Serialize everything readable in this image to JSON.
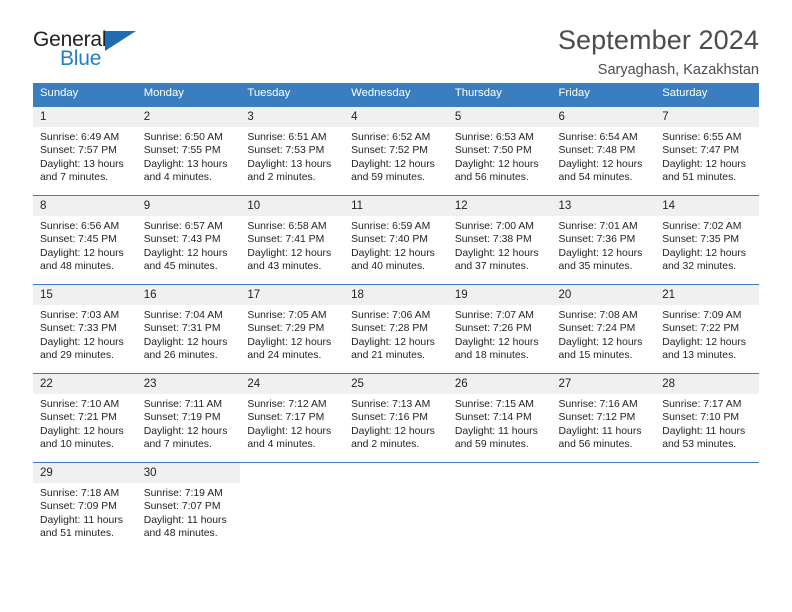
{
  "brand": {
    "name_dark": "General",
    "name_blue": "Blue",
    "triangle_color": "#1f6cb0"
  },
  "header": {
    "title": "September 2024",
    "location": "Saryaghash, Kazakhstan"
  },
  "theme": {
    "header_blue": "#3a7ebf",
    "daynum_background": "#f0f0f0",
    "text": "#231f20",
    "title_gray": "#4c4c4e"
  },
  "labels": {
    "sunrise_prefix": "Sunrise:",
    "sunset_prefix": "Sunset:",
    "daylight_prefix": "Daylight:"
  },
  "weekdays": [
    "Sunday",
    "Monday",
    "Tuesday",
    "Wednesday",
    "Thursday",
    "Friday",
    "Saturday"
  ],
  "weeks": [
    [
      {
        "day": "1",
        "sunrise": "Sunrise: 6:49 AM",
        "sunset": "Sunset: 7:57 PM",
        "daylight_line1": "Daylight: 13 hours",
        "daylight_line2": "and 7 minutes."
      },
      {
        "day": "2",
        "sunrise": "Sunrise: 6:50 AM",
        "sunset": "Sunset: 7:55 PM",
        "daylight_line1": "Daylight: 13 hours",
        "daylight_line2": "and 4 minutes."
      },
      {
        "day": "3",
        "sunrise": "Sunrise: 6:51 AM",
        "sunset": "Sunset: 7:53 PM",
        "daylight_line1": "Daylight: 13 hours",
        "daylight_line2": "and 2 minutes."
      },
      {
        "day": "4",
        "sunrise": "Sunrise: 6:52 AM",
        "sunset": "Sunset: 7:52 PM",
        "daylight_line1": "Daylight: 12 hours",
        "daylight_line2": "and 59 minutes."
      },
      {
        "day": "5",
        "sunrise": "Sunrise: 6:53 AM",
        "sunset": "Sunset: 7:50 PM",
        "daylight_line1": "Daylight: 12 hours",
        "daylight_line2": "and 56 minutes."
      },
      {
        "day": "6",
        "sunrise": "Sunrise: 6:54 AM",
        "sunset": "Sunset: 7:48 PM",
        "daylight_line1": "Daylight: 12 hours",
        "daylight_line2": "and 54 minutes."
      },
      {
        "day": "7",
        "sunrise": "Sunrise: 6:55 AM",
        "sunset": "Sunset: 7:47 PM",
        "daylight_line1": "Daylight: 12 hours",
        "daylight_line2": "and 51 minutes."
      }
    ],
    [
      {
        "day": "8",
        "sunrise": "Sunrise: 6:56 AM",
        "sunset": "Sunset: 7:45 PM",
        "daylight_line1": "Daylight: 12 hours",
        "daylight_line2": "and 48 minutes."
      },
      {
        "day": "9",
        "sunrise": "Sunrise: 6:57 AM",
        "sunset": "Sunset: 7:43 PM",
        "daylight_line1": "Daylight: 12 hours",
        "daylight_line2": "and 45 minutes."
      },
      {
        "day": "10",
        "sunrise": "Sunrise: 6:58 AM",
        "sunset": "Sunset: 7:41 PM",
        "daylight_line1": "Daylight: 12 hours",
        "daylight_line2": "and 43 minutes."
      },
      {
        "day": "11",
        "sunrise": "Sunrise: 6:59 AM",
        "sunset": "Sunset: 7:40 PM",
        "daylight_line1": "Daylight: 12 hours",
        "daylight_line2": "and 40 minutes."
      },
      {
        "day": "12",
        "sunrise": "Sunrise: 7:00 AM",
        "sunset": "Sunset: 7:38 PM",
        "daylight_line1": "Daylight: 12 hours",
        "daylight_line2": "and 37 minutes."
      },
      {
        "day": "13",
        "sunrise": "Sunrise: 7:01 AM",
        "sunset": "Sunset: 7:36 PM",
        "daylight_line1": "Daylight: 12 hours",
        "daylight_line2": "and 35 minutes."
      },
      {
        "day": "14",
        "sunrise": "Sunrise: 7:02 AM",
        "sunset": "Sunset: 7:35 PM",
        "daylight_line1": "Daylight: 12 hours",
        "daylight_line2": "and 32 minutes."
      }
    ],
    [
      {
        "day": "15",
        "sunrise": "Sunrise: 7:03 AM",
        "sunset": "Sunset: 7:33 PM",
        "daylight_line1": "Daylight: 12 hours",
        "daylight_line2": "and 29 minutes."
      },
      {
        "day": "16",
        "sunrise": "Sunrise: 7:04 AM",
        "sunset": "Sunset: 7:31 PM",
        "daylight_line1": "Daylight: 12 hours",
        "daylight_line2": "and 26 minutes."
      },
      {
        "day": "17",
        "sunrise": "Sunrise: 7:05 AM",
        "sunset": "Sunset: 7:29 PM",
        "daylight_line1": "Daylight: 12 hours",
        "daylight_line2": "and 24 minutes."
      },
      {
        "day": "18",
        "sunrise": "Sunrise: 7:06 AM",
        "sunset": "Sunset: 7:28 PM",
        "daylight_line1": "Daylight: 12 hours",
        "daylight_line2": "and 21 minutes."
      },
      {
        "day": "19",
        "sunrise": "Sunrise: 7:07 AM",
        "sunset": "Sunset: 7:26 PM",
        "daylight_line1": "Daylight: 12 hours",
        "daylight_line2": "and 18 minutes."
      },
      {
        "day": "20",
        "sunrise": "Sunrise: 7:08 AM",
        "sunset": "Sunset: 7:24 PM",
        "daylight_line1": "Daylight: 12 hours",
        "daylight_line2": "and 15 minutes."
      },
      {
        "day": "21",
        "sunrise": "Sunrise: 7:09 AM",
        "sunset": "Sunset: 7:22 PM",
        "daylight_line1": "Daylight: 12 hours",
        "daylight_line2": "and 13 minutes."
      }
    ],
    [
      {
        "day": "22",
        "sunrise": "Sunrise: 7:10 AM",
        "sunset": "Sunset: 7:21 PM",
        "daylight_line1": "Daylight: 12 hours",
        "daylight_line2": "and 10 minutes."
      },
      {
        "day": "23",
        "sunrise": "Sunrise: 7:11 AM",
        "sunset": "Sunset: 7:19 PM",
        "daylight_line1": "Daylight: 12 hours",
        "daylight_line2": "and 7 minutes."
      },
      {
        "day": "24",
        "sunrise": "Sunrise: 7:12 AM",
        "sunset": "Sunset: 7:17 PM",
        "daylight_line1": "Daylight: 12 hours",
        "daylight_line2": "and 4 minutes."
      },
      {
        "day": "25",
        "sunrise": "Sunrise: 7:13 AM",
        "sunset": "Sunset: 7:16 PM",
        "daylight_line1": "Daylight: 12 hours",
        "daylight_line2": "and 2 minutes."
      },
      {
        "day": "26",
        "sunrise": "Sunrise: 7:15 AM",
        "sunset": "Sunset: 7:14 PM",
        "daylight_line1": "Daylight: 11 hours",
        "daylight_line2": "and 59 minutes."
      },
      {
        "day": "27",
        "sunrise": "Sunrise: 7:16 AM",
        "sunset": "Sunset: 7:12 PM",
        "daylight_line1": "Daylight: 11 hours",
        "daylight_line2": "and 56 minutes."
      },
      {
        "day": "28",
        "sunrise": "Sunrise: 7:17 AM",
        "sunset": "Sunset: 7:10 PM",
        "daylight_line1": "Daylight: 11 hours",
        "daylight_line2": "and 53 minutes."
      }
    ],
    [
      {
        "day": "29",
        "sunrise": "Sunrise: 7:18 AM",
        "sunset": "Sunset: 7:09 PM",
        "daylight_line1": "Daylight: 11 hours",
        "daylight_line2": "and 51 minutes."
      },
      {
        "day": "30",
        "sunrise": "Sunrise: 7:19 AM",
        "sunset": "Sunset: 7:07 PM",
        "daylight_line1": "Daylight: 11 hours",
        "daylight_line2": "and 48 minutes."
      },
      {
        "day": "",
        "sunrise": "",
        "sunset": "",
        "daylight_line1": "",
        "daylight_line2": ""
      },
      {
        "day": "",
        "sunrise": "",
        "sunset": "",
        "daylight_line1": "",
        "daylight_line2": ""
      },
      {
        "day": "",
        "sunrise": "",
        "sunset": "",
        "daylight_line1": "",
        "daylight_line2": ""
      },
      {
        "day": "",
        "sunrise": "",
        "sunset": "",
        "daylight_line1": "",
        "daylight_line2": ""
      },
      {
        "day": "",
        "sunrise": "",
        "sunset": "",
        "daylight_line1": "",
        "daylight_line2": ""
      }
    ]
  ]
}
